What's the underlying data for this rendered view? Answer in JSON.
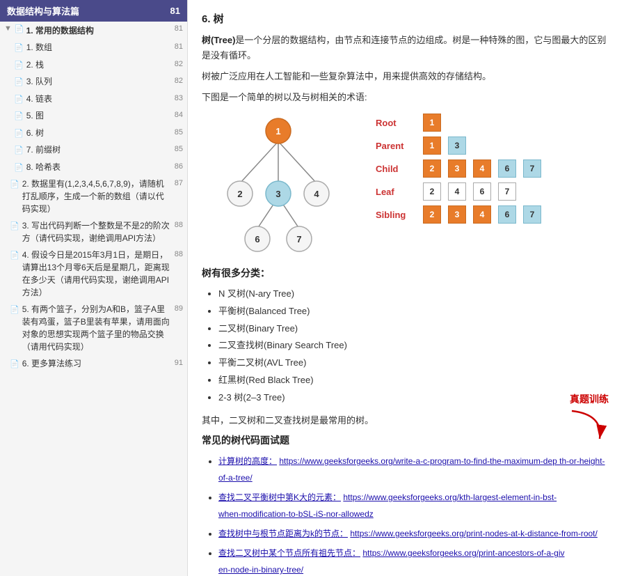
{
  "sidebar": {
    "header_title": "数据结构与算法篇",
    "header_page": "81",
    "sections": [
      {
        "id": "section1",
        "label": "1. 常用的数据结构",
        "page": "81",
        "items": [
          {
            "label": "1. 数组",
            "page": "81"
          },
          {
            "label": "2. 栈",
            "page": "82"
          },
          {
            "label": "3. 队列",
            "page": "82"
          },
          {
            "label": "4. 链表",
            "page": "83"
          },
          {
            "label": "5. 图",
            "page": "84"
          },
          {
            "label": "6. 树",
            "page": "85",
            "active": true
          },
          {
            "label": "7. 前缀树",
            "page": "85"
          },
          {
            "label": "8. 哈希表",
            "page": "86"
          }
        ]
      },
      {
        "id": "section2",
        "label": "2. 数据里有(1,2,3,4,5,6,7,8,9)，请随机打乱顺序，生成一个新的数组（请以代码实现）",
        "page": "87"
      },
      {
        "id": "section3",
        "label": "3. 写出代码判断一个整数是不是2的阶次方（请代码实现，谢绝调用API方法）",
        "page": "88"
      },
      {
        "id": "section4",
        "label": "4. 假设今日是2015年3月1日，是期日，请算出13个月零6天后是星期几，距离现在多少天（请用代码实现，谢绝调用API方法）",
        "page": "88"
      },
      {
        "id": "section5",
        "label": "5. 有两个篮子，分别为A和B，篮子A里装有鸡蛋，篮子B里装有苹果，请用面向对象的思想实现两个篮子里的物品交换（请用代码实现）",
        "page": "89"
      },
      {
        "id": "section6",
        "label": "6. 更多算法练习",
        "page": "91"
      }
    ]
  },
  "main": {
    "section_title": "6. 树",
    "intro1": "树(Tree)是一个分层的数据结构，由节点和连接节点的边组成。树是一种特殊的图，它与图最大的区别是没有循环。",
    "intro2": "树被广泛应用在人工智能和一些复杂算法中，用来提供高效的存储结构。",
    "intro3": "下图是一个简单的树以及与树相关的术语:",
    "tree_nodes": {
      "root": "1",
      "children_of_1": [
        "2",
        "3",
        "4"
      ],
      "children_of_3": [
        "6",
        "7"
      ]
    },
    "legend": {
      "root": {
        "label": "Root",
        "nodes": [
          "1"
        ],
        "styles": [
          "orange"
        ]
      },
      "parent": {
        "label": "Parent",
        "nodes": [
          "1",
          "3"
        ],
        "styles": [
          "orange",
          "light-blue"
        ]
      },
      "child": {
        "label": "Child",
        "nodes": [
          "2",
          "3",
          "4",
          "6",
          "7"
        ],
        "styles": [
          "orange",
          "orange",
          "orange",
          "light-blue",
          "light-blue"
        ]
      },
      "leaf": {
        "label": "Leaf",
        "nodes": [
          "2",
          "4",
          "6",
          "7"
        ],
        "styles": [
          "white",
          "white",
          "white",
          "white"
        ]
      },
      "sibling": {
        "label": "Sibling",
        "nodes": [
          "2",
          "3",
          "4",
          "6",
          "7"
        ],
        "styles": [
          "orange",
          "orange",
          "orange",
          "light-blue",
          "light-blue"
        ]
      }
    },
    "types_title": "树有很多分类：",
    "types": [
      "N 叉树(N-ary Tree)",
      "平衡树(Balanced Tree)",
      "二叉树(Binary Tree)",
      "二叉查找树(Binary Search Tree)",
      "平衡二叉树(AVL Tree)",
      "红黑树(Red Black Tree)",
      "2-3 树(2–3 Tree)"
    ],
    "summary": "其中，二叉树和二叉查找树是最常用的树。",
    "zhenti_label": "真题训练",
    "common_title": "常见的树代码面试题",
    "links": [
      {
        "label": "计算树的高度：",
        "url": "https://www.geeksforgeeks.org/write-a-c-program-to-find-the-maximum-depth-or-height-of-a-tree/",
        "url_display": "https://www.geeksforgeeks.org/write-a-c-program-to-find-the-maximum-dep th-or-height-of-a-tree/"
      },
      {
        "label": "查找二叉平衡树中第K大的元素：",
        "url": "https://www.geeksforgeeks.org/kth-largest-element-in-bst-when-modification-to-bst-is-not-allowed/",
        "url_display": "https://www.geeksforgeeks.org/kth-largest-element-in-bst-when-modification-to-bSL-iS-nor-allowedz"
      },
      {
        "label": "查找树中与根节点距离为k的节点：",
        "url": "https://www.geeksforgeeks.org/print-nodes-at-k-distance-from-root/",
        "url_display": "https://www.geeksforgeeks.org/print-nodes-at-k-distance-from-root/"
      },
      {
        "label": "查找二叉树中某个节点所有祖先节点：",
        "url": "https://www.geeksforgeeks.org/print-ancestors-of-a-given-node-in-binary-tree/",
        "url_display": "https://www.geeksforgeeks.org/print-ancestors-of-a-giv en-node-in-binary-tree/"
      }
    ]
  }
}
